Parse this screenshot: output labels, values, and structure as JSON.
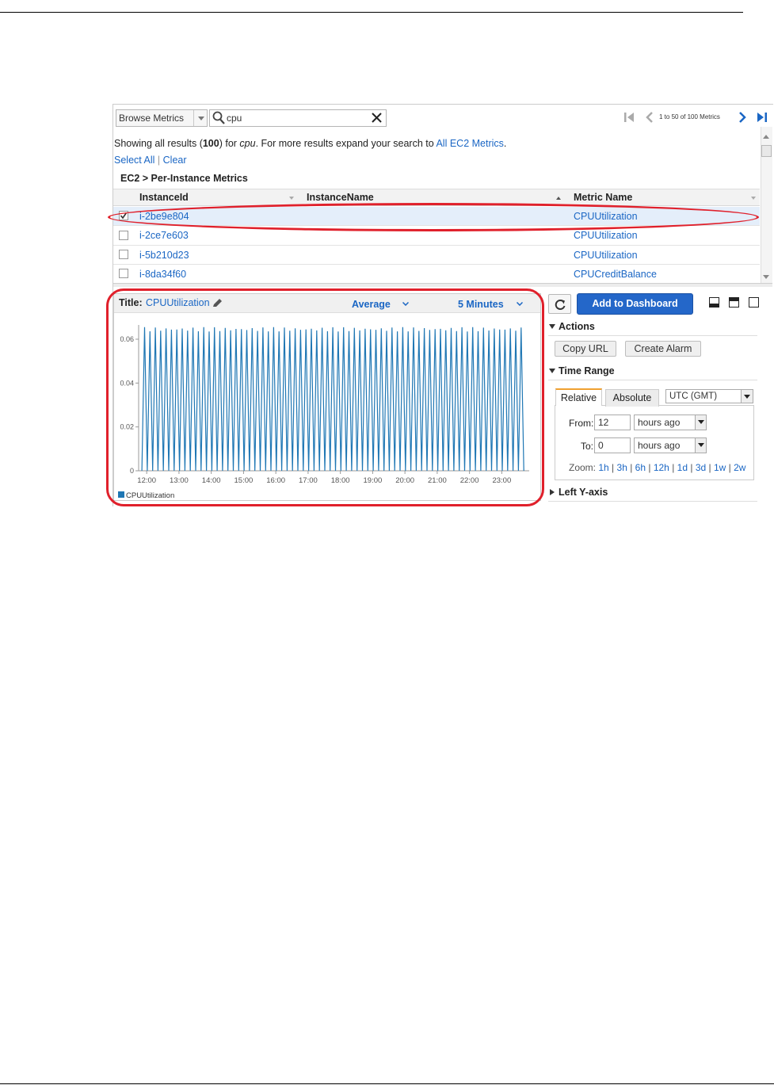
{
  "toolbar": {
    "browse_select": "Browse Metrics",
    "search_value": "cpu",
    "pager_text": "1 to 50 of 100 Metrics"
  },
  "results": {
    "prefix": "Showing all results (",
    "count": "100",
    "middle": ") for ",
    "term": "cpu",
    "suffix": ". For more results expand your search to ",
    "link": "All EC2 Metrics",
    "end": ".",
    "select_all": "Select All",
    "separator": "|",
    "clear": "Clear"
  },
  "group_title": "EC2 > Per-Instance Metrics",
  "table": {
    "columns": [
      "InstanceId",
      "InstanceName",
      "Metric Name"
    ],
    "rows": [
      {
        "id": "i-2be9e804",
        "name": "",
        "metric": "CPUUtilization",
        "checked": true
      },
      {
        "id": "i-2ce7e603",
        "name": "",
        "metric": "CPUUtilization",
        "checked": false
      },
      {
        "id": "i-5b210d23",
        "name": "",
        "metric": "CPUUtilization",
        "checked": false
      },
      {
        "id": "i-8da34f60",
        "name": "",
        "metric": "CPUCreditBalance",
        "checked": false
      }
    ]
  },
  "graph": {
    "title_label": "Title:",
    "title_value": "CPUUtilization",
    "statistic": "Average",
    "period": "5 Minutes"
  },
  "chart_data": {
    "type": "line",
    "title": "",
    "xlabel": "",
    "ylabel": "",
    "x_ticks": [
      "12:00",
      "13:00",
      "14:00",
      "15:00",
      "16:00",
      "17:00",
      "18:00",
      "19:00",
      "20:00",
      "21:00",
      "22:00",
      "23:00"
    ],
    "y_ticks": [
      "0",
      "0.02",
      "0.04",
      "0.06"
    ],
    "ylim": [
      0,
      0.0665
    ],
    "xlim_hours": [
      11.75,
      23.85
    ],
    "grid": false,
    "legend": "bottom-left",
    "series": [
      {
        "name": "CPUUtilization",
        "color": "#1f77b4",
        "pattern": "alternating 0 / ~0.066 every 5 minutes",
        "x_start_hour": 11.85,
        "x_end_hour": 23.7,
        "peak": 0.0655,
        "trough": 0
      }
    ]
  },
  "right_panel": {
    "add_button": "Add to Dashboard",
    "actions_title": "Actions",
    "copy_url": "Copy URL",
    "create_alarm": "Create Alarm",
    "time_range_title": "Time Range",
    "tab_relative": "Relative",
    "tab_absolute": "Absolute",
    "timezone": "UTC (GMT)",
    "from_label": "From:",
    "from_value": "12",
    "from_unit": "hours ago",
    "to_label": "To:",
    "to_value": "0",
    "to_unit": "hours ago",
    "zoom_label": "Zoom:",
    "zoom_options": [
      "1h",
      "3h",
      "6h",
      "12h",
      "1d",
      "3d",
      "1w",
      "2w"
    ],
    "left_y_axis": "Left Y-axis"
  },
  "colors": {
    "link": "#1a66c4",
    "primary_button": "#2467c9",
    "annotation": "#e0202b",
    "series": "#1f77b4"
  }
}
